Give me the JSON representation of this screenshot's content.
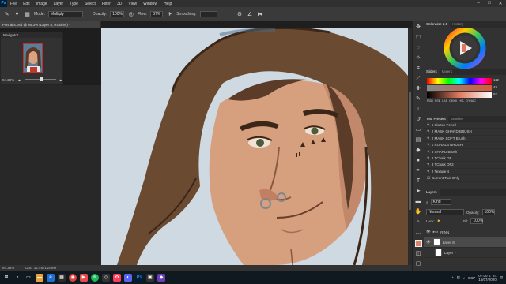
{
  "menubar": {
    "logo": "Ps",
    "items": [
      "File",
      "Edit",
      "Image",
      "Layer",
      "Type",
      "Select",
      "Filter",
      "3D",
      "View",
      "Window",
      "Help"
    ],
    "window_controls": [
      "–",
      "□",
      "✕"
    ]
  },
  "options": {
    "mode_label": "Mode:",
    "mode_value": "Multiply",
    "opacity_label": "Opacity:",
    "opacity_value": "100%",
    "flow_label": "Flow:",
    "flow_value": "37%",
    "smoothing_label": "Smoothing:",
    "smoothing_value": ""
  },
  "document": {
    "tab_title": "Portraits.psd @ 94.3% (Layer 8, RGB/8#) *",
    "zoom": "94.28%",
    "doc_info": "Doc: 12.4M/115.6M"
  },
  "navigator": {
    "title": "Navigator",
    "zoom": "94.28%"
  },
  "color_panel": {
    "tabs": [
      "Colorwise 2.5",
      "History"
    ],
    "wheel_icon": "play-icon"
  },
  "sliders_panel": {
    "tabs": [
      "Sliders",
      "Mixers"
    ],
    "values": [
      "112",
      "48",
      "93"
    ],
    "modes": [
      "RGB",
      "HSB",
      "LAB",
      "CMYK",
      "HSL",
      "DYNAC"
    ]
  },
  "tool_presets": {
    "tabs": [
      "Tool Presets",
      "Brushes"
    ],
    "items": [
      "6 Sketch Pencil",
      "2 MASK GHARD BRUSH",
      "2 MASK SOFT Brush",
      "1 RONALB BRUSH",
      "3 SHARD Brush",
      "2 TChalk OF",
      "3 TChalk OF2",
      "2 Texture 4"
    ],
    "current_tool_only": "Current Tool Only"
  },
  "layers_panel": {
    "title": "Layers",
    "filter_label": "Kind",
    "blend_mode": "Normal",
    "opacity_label": "Opacity:",
    "opacity_value": "100%",
    "lock_label": "Lock:",
    "fill_label": "Fill:",
    "fill_value": "100%",
    "group_name": "RINN",
    "layers": [
      "Layer 8",
      "Layer 7"
    ]
  },
  "taskbar": {
    "search_placeholder": "",
    "tray_lang": "ESP",
    "time": "07:00 p. m.",
    "date": "16/07/2020"
  },
  "colors": {
    "accent": "#31a8ff",
    "canvas_bg": "#cfd9e2",
    "hair": "#6b4a32",
    "skin": "#d29a7a"
  }
}
